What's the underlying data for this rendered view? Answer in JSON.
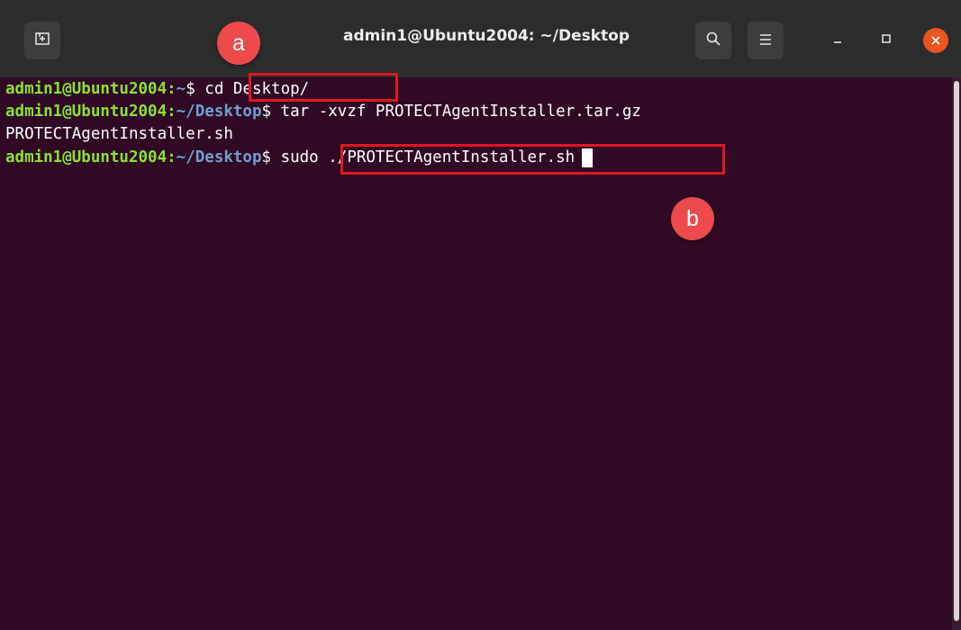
{
  "window": {
    "title": "admin1@Ubuntu2004: ~/Desktop"
  },
  "icons": {
    "new_tab": "new-tab-icon",
    "search": "search-icon",
    "menu": "hamburger-menu-icon",
    "minimize": "minimize-icon",
    "maximize": "maximize-icon",
    "close": "close-icon"
  },
  "colors": {
    "terminal_bg": "#300a24",
    "prompt_user": "#8ae234",
    "prompt_path": "#729fcf",
    "highlight": "#e0161f",
    "badge": "#ec4a4d",
    "close_button": "#e95420"
  },
  "terminal": {
    "lines": [
      {
        "user": "admin1@Ubuntu2004",
        "colon": ":",
        "path": "~",
        "dollar": "$ ",
        "command": "cd Desktop/"
      },
      {
        "user": "admin1@Ubuntu2004",
        "colon": ":",
        "path": "~/Desktop",
        "dollar": "$ ",
        "command": "tar -xvzf PROTECTAgentInstaller.tar.gz"
      },
      {
        "output": "PROTECTAgentInstaller.sh"
      },
      {
        "user": "admin1@Ubuntu2004",
        "colon": ":",
        "path": "~/Desktop",
        "dollar": "$ ",
        "command": "sudo ./PROTECTAgentInstaller.sh"
      }
    ]
  },
  "annotations": {
    "a": "a",
    "b": "b"
  }
}
